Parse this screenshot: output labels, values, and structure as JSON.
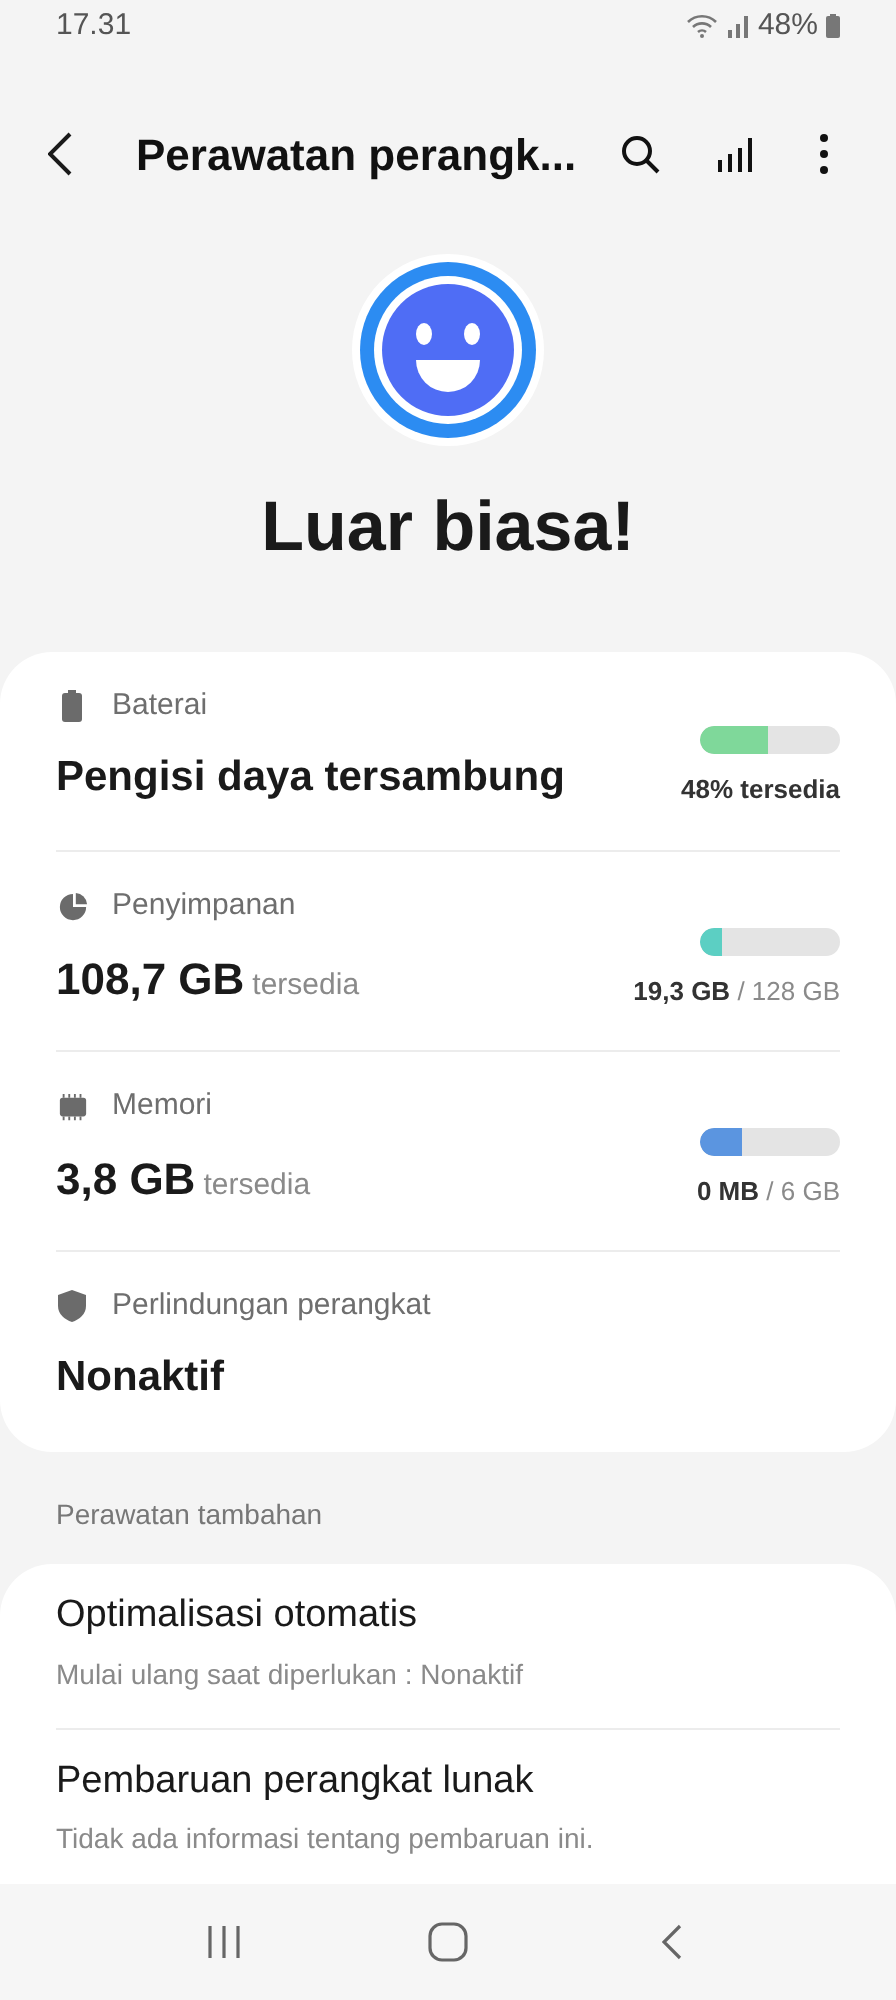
{
  "status_bar": {
    "time": "17.31",
    "battery": "48%"
  },
  "header": {
    "title": "Perawatan perangk..."
  },
  "status": {
    "title": "Luar biasa!"
  },
  "metrics": [
    {
      "kind": "battery",
      "label": "Baterai",
      "value": "Pengisi daya tersambung",
      "level": 0.48,
      "color": "#7fd89a",
      "reading": "**48% tersedia**"
    },
    {
      "kind": "storage",
      "label": "Penyimpanan",
      "value": "108,7 GB",
      "unit": "tersedia",
      "level": 0.15,
      "color": "#5ccfc3",
      "reading": "**19,3 GB** / 128 GB"
    },
    {
      "kind": "memory",
      "label": "Memori",
      "value": "3,8 GB",
      "unit": "tersedia",
      "level": 0.3,
      "color": "#5b95e0",
      "reading": "**0 MB** / 6 GB"
    },
    {
      "kind": "protection",
      "label": "Perlindungan perangkat",
      "value": "Nonaktif"
    }
  ],
  "section": {
    "title": "Perawatan tambahan"
  },
  "extras": [
    {
      "title": "Optimalisasi otomatis",
      "subtitle": "Mulai ulang saat diperlukan : Nonaktif"
    },
    {
      "title": "Pembaruan perangkat lunak",
      "subtitle": "Tidak ada informasi tentang pembaruan ini."
    }
  ]
}
